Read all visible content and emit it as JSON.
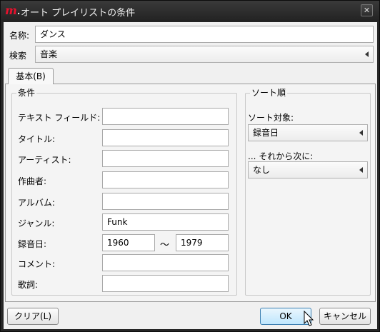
{
  "window": {
    "title": "オート プレイリストの条件",
    "logo": "m",
    "close_glyph": "✕"
  },
  "header": {
    "name_label": "名称:",
    "name_value": "ダンス",
    "search_label": "検索",
    "search_value": "音楽"
  },
  "tabs": [
    {
      "label": "基本(B)"
    }
  ],
  "conditions": {
    "legend": "条件",
    "fields": [
      {
        "label": "テキスト フィールド:",
        "value": ""
      },
      {
        "label": "タイトル:",
        "value": ""
      },
      {
        "label": "アーティスト:",
        "value": ""
      },
      {
        "label": "作曲者:",
        "value": ""
      },
      {
        "label": "アルバム:",
        "value": ""
      },
      {
        "label": "ジャンル:",
        "value": "Funk"
      }
    ],
    "date": {
      "label": "録音日:",
      "from": "1960",
      "separator": "～",
      "to": "1979"
    },
    "comment": {
      "label": "コメント:",
      "value": ""
    },
    "lyrics": {
      "label": "歌詞:",
      "value": ""
    }
  },
  "sort": {
    "legend": "ソート順",
    "target_label": "ソート対象:",
    "target_value": "録音日",
    "then_label": "... それから次に:",
    "then_value": "なし"
  },
  "buttons": {
    "clear": "クリア(L)",
    "ok": "OK",
    "cancel": "キャンセル"
  }
}
